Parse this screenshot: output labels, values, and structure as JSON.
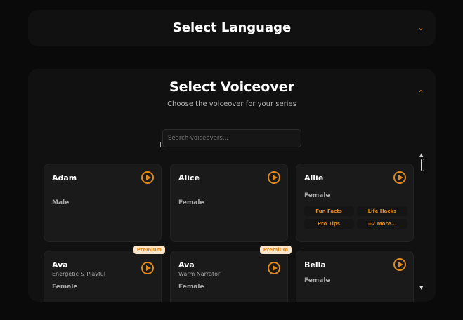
{
  "language": {
    "title": "Select Language"
  },
  "voiceover": {
    "title": "Select Voiceover",
    "subtitle": "Choose the voiceover for your  series",
    "search_placeholder": "Search voiceovers..."
  },
  "cards": [
    {
      "name": "Adam",
      "gender": "Male"
    },
    {
      "name": "Alice",
      "gender": "Female"
    },
    {
      "name": "Allie",
      "gender": "Female",
      "tags": [
        "Fun Facts",
        "Life Hacks",
        "Pro Tips",
        "+2 More..."
      ]
    },
    {
      "name": "Ava",
      "desc": "Energetic & Playful",
      "gender": "Female",
      "badge": "Premium"
    },
    {
      "name": "Ava",
      "desc": "Warm Narrator",
      "gender": "Female",
      "badge": "Premium"
    },
    {
      "name": "Bella",
      "gender": "Female"
    }
  ],
  "colors": {
    "accent": "#e08a1e",
    "badge_bg": "#fbe6cc"
  }
}
